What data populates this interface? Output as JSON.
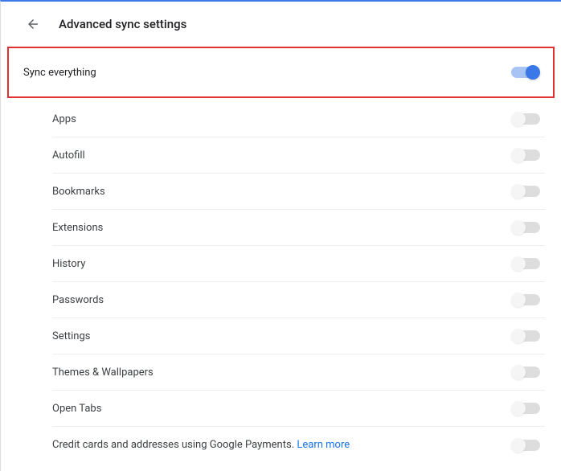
{
  "header": {
    "title": "Advanced sync settings"
  },
  "syncEverything": {
    "label": "Sync everything",
    "on": true
  },
  "items": [
    {
      "label": "Apps",
      "on": false,
      "disabled": true
    },
    {
      "label": "Autofill",
      "on": false,
      "disabled": true
    },
    {
      "label": "Bookmarks",
      "on": false,
      "disabled": true
    },
    {
      "label": "Extensions",
      "on": false,
      "disabled": true
    },
    {
      "label": "History",
      "on": false,
      "disabled": true
    },
    {
      "label": "Passwords",
      "on": false,
      "disabled": true
    },
    {
      "label": "Settings",
      "on": false,
      "disabled": true
    },
    {
      "label": "Themes & Wallpapers",
      "on": false,
      "disabled": true
    },
    {
      "label": "Open Tabs",
      "on": false,
      "disabled": true
    }
  ],
  "credit": {
    "labelPrefix": "Credit cards and addresses using Google Payments. ",
    "linkText": "Learn more",
    "on": false,
    "disabled": true
  }
}
